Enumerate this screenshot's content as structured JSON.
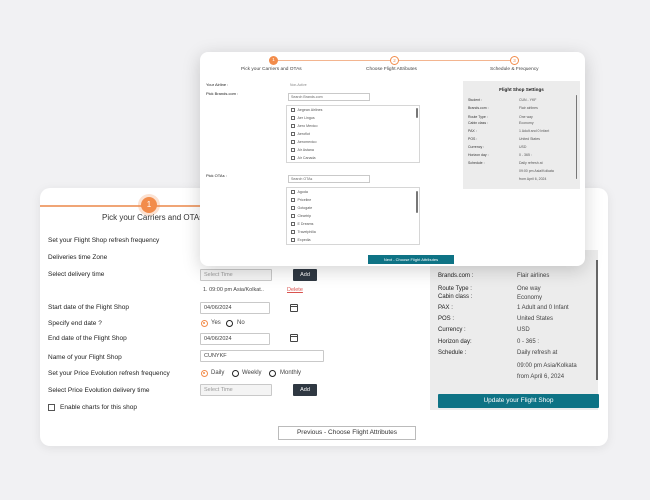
{
  "back": {
    "step_number": "1",
    "step_label": "Pick your Carriers and OTAs",
    "refresh_label": "Set your Flight Shop refresh frequency",
    "deliveries_tz_label": "Deliveries time Zone",
    "delivery_time_label": "Select delivery time",
    "select_time_placeholder": "Select Time",
    "add_label": "Add",
    "time_entry": "1. 09:00 pm Asia/Kolkat..",
    "delete_label": "Delete",
    "start_date_label": "Start date of the Flight Shop",
    "start_date_value": "04/06/2024",
    "specify_end_label": "Specify end date ?",
    "yes_label": "Yes",
    "no_label": "No",
    "end_date_label": "End date of the Flight Shop",
    "end_date_value": "04/06/2024",
    "name_label": "Name of your Flight Shop",
    "name_value": "CUNYKF",
    "price_freq_label": "Set your Price Evolution refresh frequency",
    "daily_label": "Daily",
    "weekly_label": "Weekly",
    "monthly_label": "Monthly",
    "price_delivery_label": "Select Price Evolution delivery time",
    "select_time_placeholder2": "Select Time",
    "add_label2": "Add",
    "charts_label": "Enable charts for this shop",
    "prev_button": "Previous - Choose Flight Attributes",
    "update_button": "Update your Flight Shop",
    "settings": [
      {
        "k": "Brands.com :",
        "v": "Flair airlines"
      },
      {
        "k": "Route Type :",
        "v": "One way"
      },
      {
        "k": "Cabin class :",
        "v": "Economy"
      },
      {
        "k": "PAX :",
        "v": "1 Adult and 0 Infant"
      },
      {
        "k": "POS :",
        "v": "United States"
      },
      {
        "k": "Currency :",
        "v": "USD"
      },
      {
        "k": "Horizon day:",
        "v": "0 - 365 :"
      },
      {
        "k": "Schedule :",
        "v": "Daily refresh at"
      }
    ],
    "schedule_extra": [
      "09:00 pm Asia/Kolkata",
      "from April 6, 2024"
    ]
  },
  "front": {
    "steps": [
      {
        "n": "1",
        "label": "Pick your Carriers and OTAs"
      },
      {
        "n": "2",
        "label": "Choose Flight Attributes"
      },
      {
        "n": "3",
        "label": "Schedule & Frequency"
      }
    ],
    "your_airline_label": "Your Airline :",
    "non_active_label": "Non-Active",
    "pick_brands_label": "Pick Brands.com :",
    "search_brands_placeholder": "Search Brands.com",
    "brands": [
      "Aegean Airlines",
      "Aer Lingus",
      "Aero Mexico",
      "Aeroflot",
      "Aeromexico",
      "Air Astana",
      "Air Canada"
    ],
    "pick_otas_label": "Pick OTAs :",
    "search_otas_placeholder": "Search OTAs",
    "otas": [
      "Agoda",
      "Priceline",
      "Gotogate",
      "Cleartrip",
      "E Dreams",
      "Travelphilia",
      "Expedia"
    ],
    "settings_title": "Flight Shop Settings",
    "settings": [
      {
        "k": "Student :",
        "v": "CUN - YKF"
      },
      {
        "k": "Brands.com :",
        "v": "Flair airlines"
      },
      {
        "k": "Route Type :",
        "v": "One way"
      },
      {
        "k": "Cabin class :",
        "v": "Economy"
      },
      {
        "k": "PAX :",
        "v": "1 Adult and 0 Infant"
      },
      {
        "k": "POS :",
        "v": "United States"
      },
      {
        "k": "Currency :",
        "v": "USD"
      },
      {
        "k": "Horizon day :",
        "v": "0 - 365 :"
      },
      {
        "k": "Schedule :",
        "v": "Daily refresh at"
      }
    ],
    "schedule_extra": [
      "09:00 pm Asia/Kolkata",
      "from April 6, 2024"
    ],
    "next_button": "Next - Choose Flight Attributes"
  }
}
